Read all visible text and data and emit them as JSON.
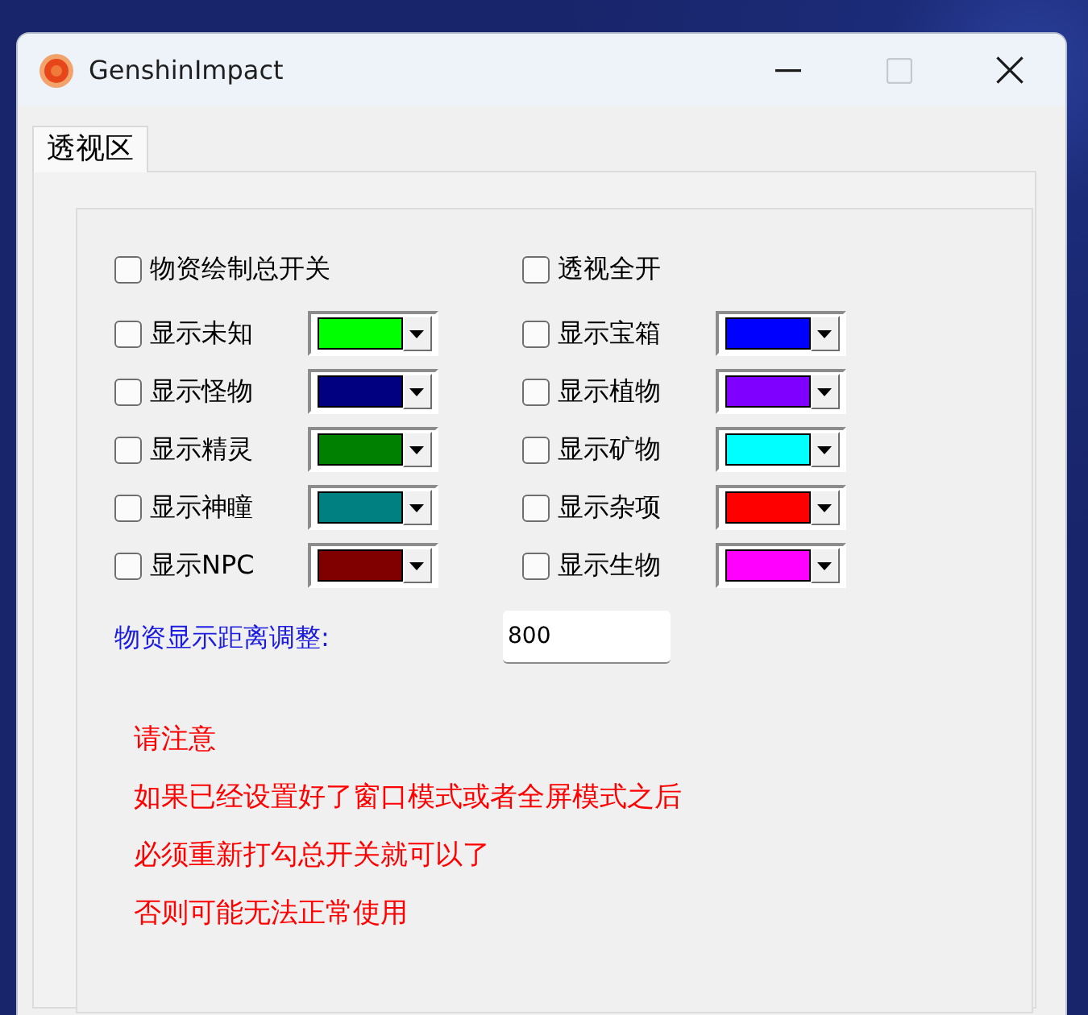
{
  "window": {
    "title": "GenshinImpact",
    "maximize_disabled": true
  },
  "tabs": [
    {
      "label": "透视区",
      "selected": true
    }
  ],
  "master_toggles": [
    {
      "label": "物资绘制总开关",
      "checked": false
    },
    {
      "label": "透视全开",
      "checked": false
    }
  ],
  "categories": [
    {
      "label": "显示未知",
      "checked": false,
      "color": "#00ff00"
    },
    {
      "label": "显示宝箱",
      "checked": false,
      "color": "#0000ff"
    },
    {
      "label": "显示怪物",
      "checked": false,
      "color": "#000080"
    },
    {
      "label": "显示植物",
      "checked": false,
      "color": "#8000ff"
    },
    {
      "label": "显示精灵",
      "checked": false,
      "color": "#008000"
    },
    {
      "label": "显示矿物",
      "checked": false,
      "color": "#00ffff"
    },
    {
      "label": "显示神瞳",
      "checked": false,
      "color": "#008080"
    },
    {
      "label": "显示杂项",
      "checked": false,
      "color": "#ff0000"
    },
    {
      "label": "显示NPC",
      "checked": false,
      "color": "#800000"
    },
    {
      "label": "显示生物",
      "checked": false,
      "color": "#ff00ff"
    }
  ],
  "distance": {
    "label": "物资显示距离调整:",
    "value": "800"
  },
  "notes": [
    "请注意",
    "如果已经设置好了窗口模式或者全屏模式之后",
    "必须重新打勾总开关就可以了",
    "否则可能无法正常使用"
  ]
}
